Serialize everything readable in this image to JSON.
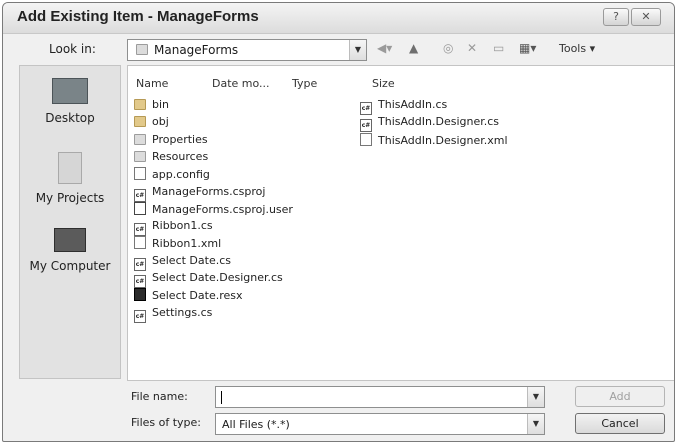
{
  "dialog": {
    "title": "Add Existing Item - ManageForms",
    "help_button": "?",
    "close_button": "✕"
  },
  "lookin": {
    "label": "Look in:",
    "value": "ManageForms",
    "tools_label": "Tools"
  },
  "places": [
    {
      "label": "Desktop",
      "icon": "desktop-icon"
    },
    {
      "label": "My Projects",
      "icon": "folder-icon"
    },
    {
      "label": "My Computer",
      "icon": "computer-icon"
    }
  ],
  "columns": [
    "Name",
    "Date mo...",
    "Type",
    "Size"
  ],
  "files_left": [
    {
      "name": "bin",
      "icon": "folder"
    },
    {
      "name": "obj",
      "icon": "folder"
    },
    {
      "name": "Properties",
      "icon": "folder"
    },
    {
      "name": "Resources",
      "icon": "folder"
    },
    {
      "name": "app.config",
      "icon": "doc"
    },
    {
      "name": "ManageForms.csproj",
      "icon": "cs"
    },
    {
      "name": "ManageForms.csproj.user",
      "icon": "proj"
    },
    {
      "name": "Ribbon1.cs",
      "icon": "cs"
    },
    {
      "name": "Ribbon1.xml",
      "icon": "doc"
    },
    {
      "name": "Select Date.cs",
      "icon": "cs"
    },
    {
      "name": "Select Date.Designer.cs",
      "icon": "cs"
    },
    {
      "name": "Select Date.resx",
      "icon": "resx"
    },
    {
      "name": "Settings.cs",
      "icon": "cs"
    }
  ],
  "files_right": [
    {
      "name": "ThisAddIn.cs",
      "icon": "cs"
    },
    {
      "name": "ThisAddIn.Designer.cs",
      "icon": "cs"
    },
    {
      "name": "ThisAddIn.Designer.xml",
      "icon": "doc"
    }
  ],
  "filename": {
    "label": "File name:",
    "value": ""
  },
  "filetype": {
    "label": "Files of type:",
    "value": "All Files (*.*)"
  },
  "buttons": {
    "add": "Add",
    "cancel": "Cancel"
  }
}
